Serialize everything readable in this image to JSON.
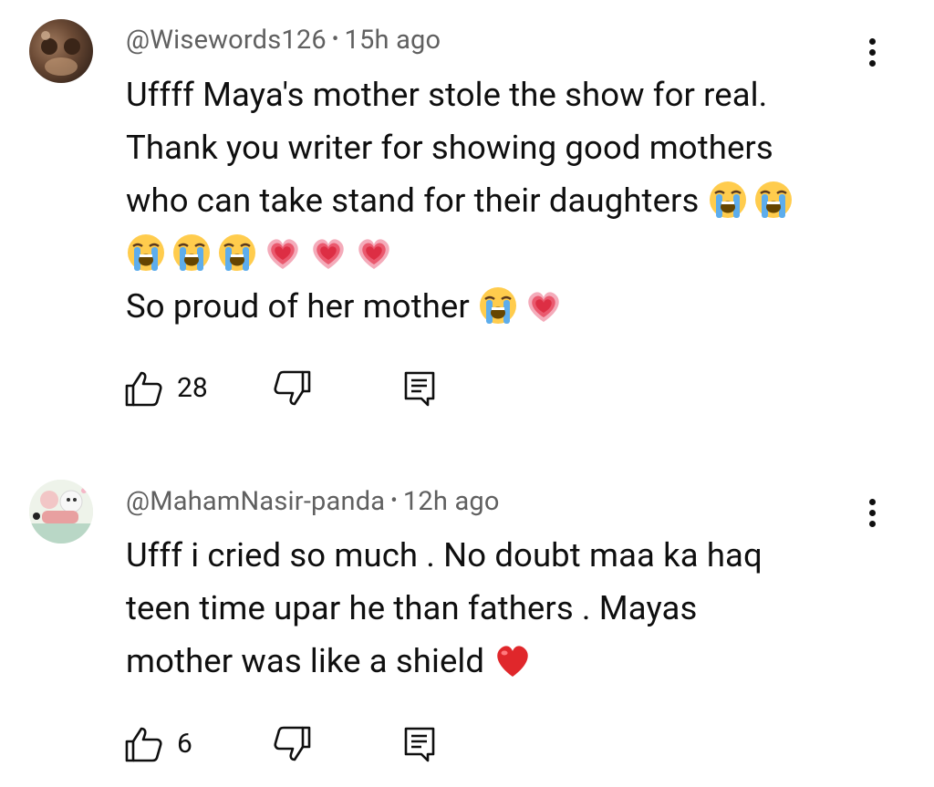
{
  "comments": [
    {
      "author": "@Wisewords126",
      "separator": "•",
      "time": "15h ago",
      "lines": [
        "Uffff Maya's mother stole the show for real.",
        "Thank you writer for showing good mothers",
        "who can take stand for their daughters 😭😭",
        "😭😭😭💗💗💗",
        "So proud of her mother 😭💗"
      ],
      "likes": "28"
    },
    {
      "author": "@MahamNasir-panda",
      "separator": "•",
      "time": "12h ago",
      "lines": [
        "Ufff i cried so much . No doubt maa ka haq",
        "teen time upar he than fathers . Mayas",
        "mother was like a shield ❤️"
      ],
      "likes": "6"
    }
  ],
  "icons": {
    "like": "thumbs-up-icon",
    "dislike": "thumbs-down-icon",
    "reply": "reply-icon",
    "more": "more-vertical-icon"
  }
}
